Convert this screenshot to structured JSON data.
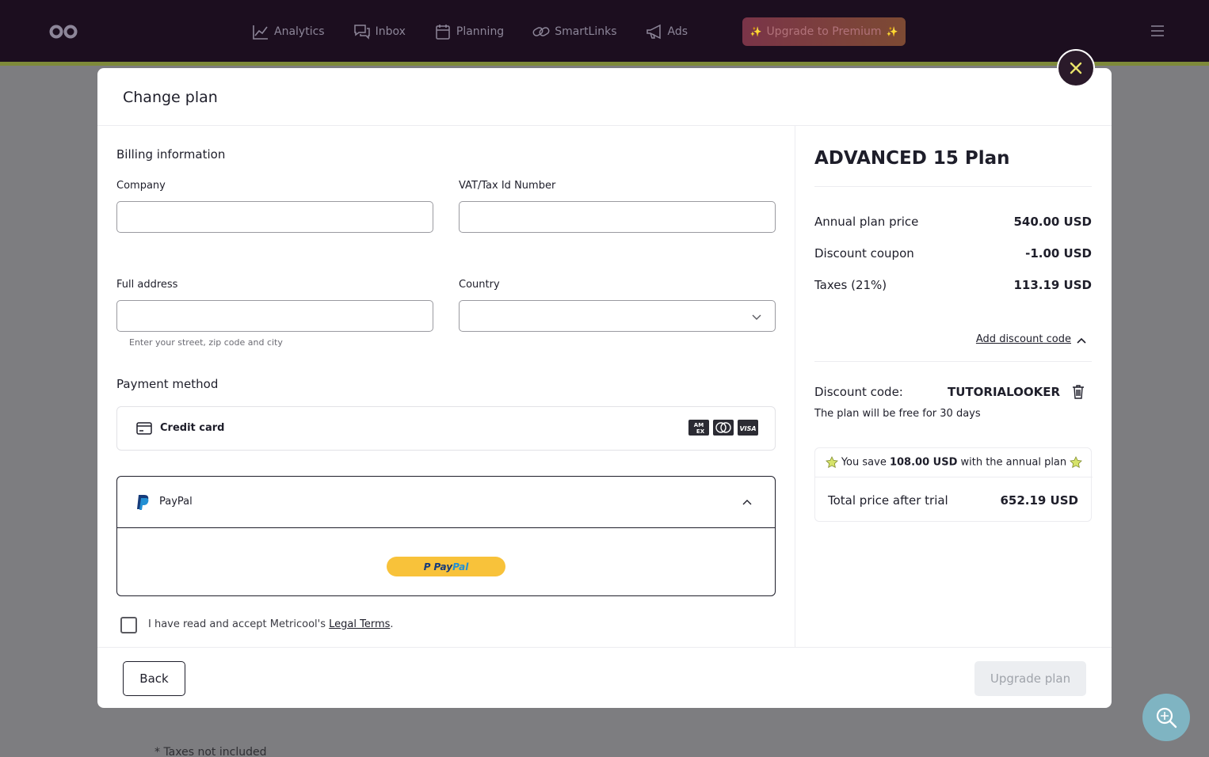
{
  "nav": {
    "items": [
      {
        "label": "Analytics",
        "icon": "analytics-chart-icon"
      },
      {
        "label": "Inbox",
        "icon": "chat-bubbles-icon"
      },
      {
        "label": "Planning",
        "icon": "calendar-icon"
      },
      {
        "label": "SmartLinks",
        "icon": "link-icon"
      },
      {
        "label": "Ads",
        "icon": "megaphone-icon"
      }
    ],
    "premium_label": "Upgrade to Premium",
    "colors": {
      "bar": "#1c0e1f",
      "accent": "#7e8a3a"
    }
  },
  "background": {
    "note": "* Taxes not included"
  },
  "modal": {
    "title": "Change plan",
    "billing": {
      "title": "Billing information",
      "company_label": "Company",
      "company_value": "",
      "vat_label": "VAT/Tax Id Number",
      "vat_value": "",
      "address_label": "Full address",
      "address_value": "",
      "address_hint": "Enter your street, zip code and city",
      "country_label": "Country",
      "country_value": ""
    },
    "payment": {
      "title": "Payment method",
      "credit_card_label": "Credit card",
      "card_brands": [
        "AMEX",
        "Mastercard",
        "VISA"
      ],
      "paypal_label": "PayPal",
      "paypal_button": {
        "pay": "Pay",
        "pal": "Pal"
      }
    },
    "terms": {
      "checked": false,
      "prefix": "I have read and accept Metricool's ",
      "link": "Legal Terms",
      "suffix": "."
    },
    "summary": {
      "plan_name": "ADVANCED 15 Plan",
      "rows": [
        {
          "label": "Annual plan price",
          "value": "540.00 USD"
        },
        {
          "label": "Discount coupon",
          "value": "-1.00 USD"
        },
        {
          "label": "Taxes (21%)",
          "value": "113.19 USD"
        }
      ],
      "add_discount_label": "Add discount code",
      "discount_code_label": "Discount code:",
      "discount_code_value": "TUTORIALOOKER",
      "free_note": "The plan will be free for 30 days",
      "save_prefix": "You save ",
      "save_amount": "108.00 USD",
      "save_suffix": " with the annual plan",
      "total_label": "Total price after trial",
      "total_value": "652.19 USD"
    },
    "footer": {
      "back_label": "Back",
      "upgrade_label": "Upgrade plan"
    }
  }
}
